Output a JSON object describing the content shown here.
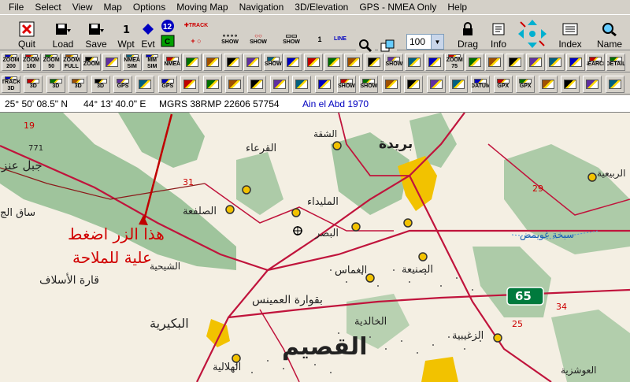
{
  "menu": [
    "File",
    "Select",
    "View",
    "Map",
    "Options",
    "Moving Map",
    "Navigation",
    "3D/Elevation",
    "GPS - NMEA Only",
    "Help"
  ],
  "toolbar": {
    "quit": "Quit",
    "load": "Load",
    "save": "Save",
    "wpt": "Wpt",
    "evt": "Evt",
    "track": "TRACK",
    "show": "SHOW",
    "line": "LINE",
    "zoom_value": "100",
    "drag": "Drag",
    "info": "Info",
    "index": "Index",
    "name": "Name",
    "track_count": "12"
  },
  "row2_labels": [
    "ZOOM 200",
    "ZOOM 100",
    "ZOOM 50",
    "ZOOM FULL",
    "ZOOM",
    "",
    "NMEA SIM",
    "MM SIM",
    "NMEA",
    "",
    "",
    "",
    "",
    "SHOW",
    "",
    "",
    "",
    "",
    "",
    "SHOW",
    "",
    "",
    "ZOOM 75",
    "",
    "",
    "",
    "",
    "",
    "",
    "SEARCH",
    "DETAIL"
  ],
  "row3_labels": [
    "TRACK 3D",
    "3D",
    "3D",
    "3D",
    "3D",
    "GPS",
    "",
    "GPS",
    "",
    "",
    "",
    "",
    "",
    "",
    "",
    "SHOW",
    "SHOW",
    "",
    "",
    "",
    "",
    "DATUM",
    "GPX",
    "GPX",
    "",
    "",
    "",
    ""
  ],
  "status": {
    "lat": "25° 50' 08.5\" N",
    "lon": "44° 13' 40.0\" E",
    "mgrs": "MGRS 38RMP  22606 57754",
    "datum": "Ain el Abd 1970"
  },
  "map": {
    "annotation_line1": "هذا الزر اضغط",
    "annotation_line2": "علية للملاحة",
    "places": [
      "بريدة",
      "الشقة",
      "القرعاء",
      "جبل عنز",
      "الصلفعة",
      "المليداء",
      "البصر",
      "ساق الج",
      "قارة الأسلاف",
      "الشيحية",
      "الغماس",
      "الصنيعة",
      "بقوارة العمينس",
      "الخالدية",
      "البكيرية",
      "القصيم",
      "الهلالية",
      "الزغيبية",
      "سبخة غويمض",
      "الربيعية",
      "العوشزية"
    ],
    "elevations": [
      "771",
      "19",
      "31",
      "34",
      "29",
      "25"
    ],
    "highway_shield": "65"
  }
}
